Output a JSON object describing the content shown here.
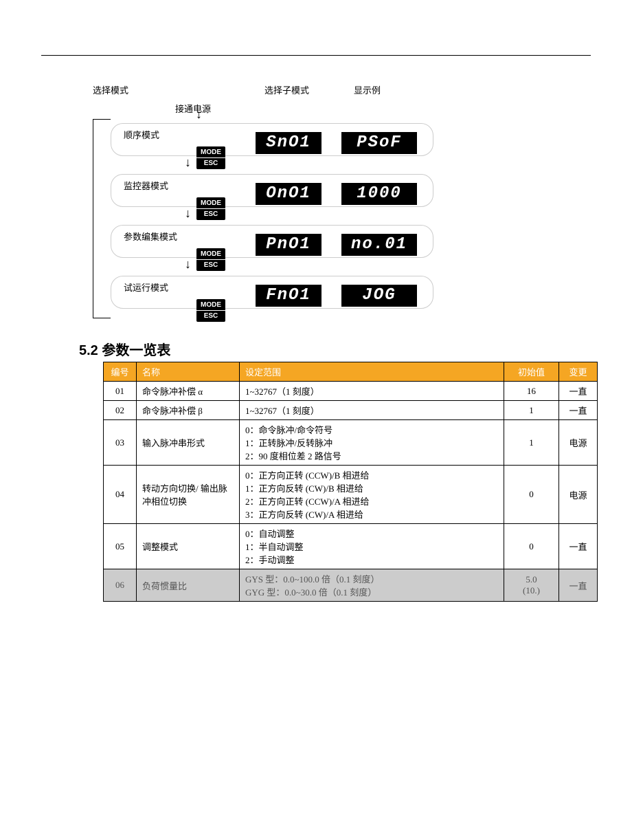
{
  "headers": {
    "select_mode": "选择模式",
    "select_submode": "选择子模式",
    "display_example": "显示例",
    "power_on": "接通电源"
  },
  "button": {
    "line1": "MODE",
    "line2": "ESC"
  },
  "modes": [
    {
      "label": "顺序模式",
      "sub_display": "SnO1",
      "ex_display": "PSoF"
    },
    {
      "label": "监控器模式",
      "sub_display": "OnO1",
      "ex_display": "1000"
    },
    {
      "label": "参数编集模式",
      "sub_display": "PnO1",
      "ex_display": "no.01"
    },
    {
      "label": "试运行模式",
      "sub_display": "FnO1",
      "ex_display": "JOG"
    }
  ],
  "section_5_2": "5.2  参数一览表",
  "table": {
    "headers": {
      "no": "编号",
      "name": "名称",
      "range": "设定范围",
      "init": "初始值",
      "change": "变更"
    },
    "rows": [
      {
        "no": "01",
        "name": "命令脉冲补偿 α",
        "range": "1~32767（1 刻度）",
        "init": "16",
        "change": "一直",
        "shade": false
      },
      {
        "no": "02",
        "name": "命令脉冲补偿 β",
        "range": "1~32767（1 刻度）",
        "init": "1",
        "change": "一直",
        "shade": false
      },
      {
        "no": "03",
        "name": "输入脉冲串形式",
        "range": "0：命令脉冲/命令符号\n1：正转脉冲/反转脉冲\n2：90 度相位差 2 路信号",
        "init": "1",
        "change": "电源",
        "shade": false
      },
      {
        "no": "04",
        "name": "转动方向切换/\n输出脉冲相位切换",
        "range": "0：正方向正转 (CCW)/B 相进给\n1：正方向反转 (CW)/B 相进给\n2：正方向正转 (CCW)/A 相进给\n3：正方向反转 (CW)/A 相进给",
        "init": "0",
        "change": "电源",
        "shade": false
      },
      {
        "no": "05",
        "name": "调整模式",
        "range": "0：自动调整\n1：半自动调整\n2：手动调整",
        "init": "0",
        "change": "一直",
        "shade": false
      },
      {
        "no": "06",
        "name": "负荷惯量比",
        "range": "GYS 型：0.0~100.0 倍（0.1 刻度）\nGYG 型：0.0~30.0 倍（0.1 刻度）",
        "init": "5.0\n(10.)",
        "change": "一直",
        "shade": true
      }
    ]
  }
}
